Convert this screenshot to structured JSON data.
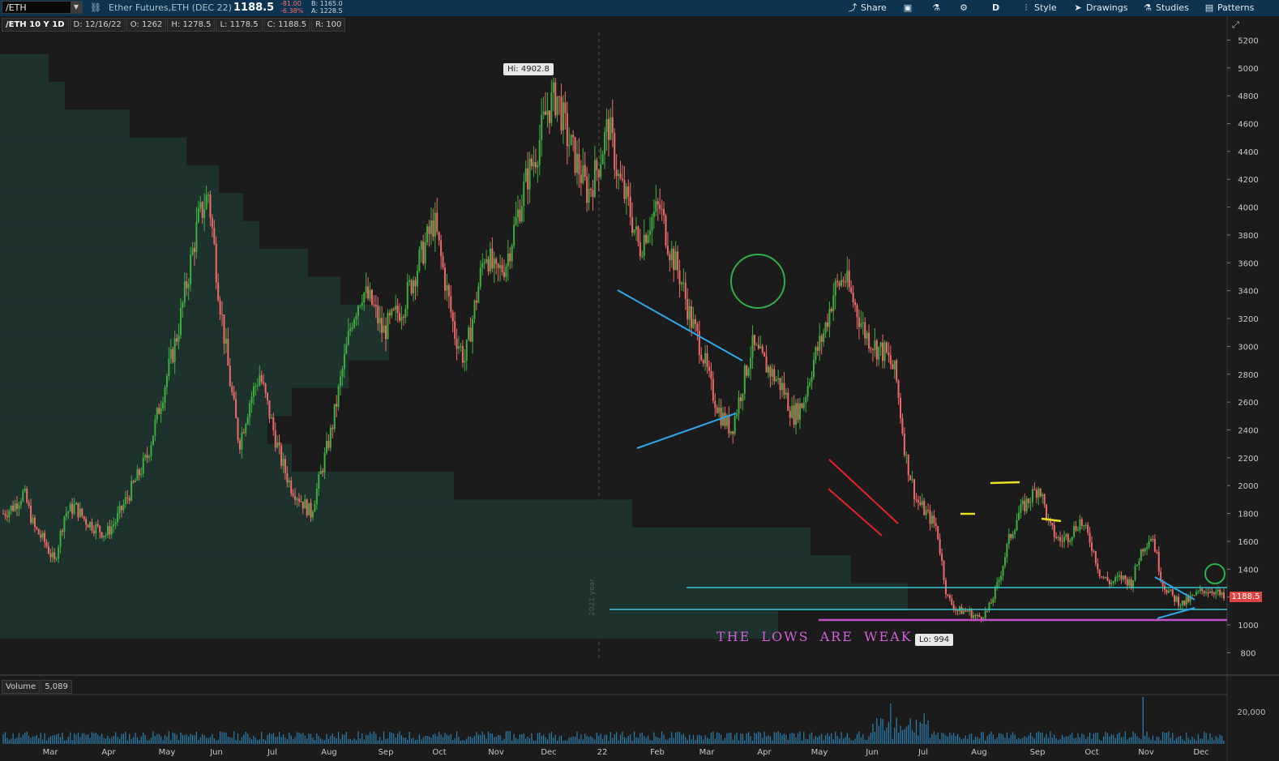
{
  "toolbar": {
    "symbol": "/ETH",
    "description": "Ether Futures,ETH (DEC 22)",
    "last_price": "1188.5",
    "change": "-81.00",
    "change_pct": "-6.38%",
    "bid": "B: 1165.0",
    "ask": "A: 1228.5",
    "share": "Share",
    "period": "D",
    "style": "Style",
    "drawings": "Drawings",
    "studies": "Studies",
    "patterns": "Patterns"
  },
  "info": {
    "chart_id": "/ETH 10 Y 1D",
    "date": "D: 12/16/22",
    "open": "O: 1262",
    "high": "H: 1278.5",
    "low": "L: 1178.5",
    "close": "C: 1188.5",
    "range": "R: 100"
  },
  "volume_info": {
    "label": "Volume",
    "value": "5,089"
  },
  "annotations": {
    "hi": "Hi: 4902.8",
    "lo": "Lo: 994",
    "lows_text": "THE LOWS ARE WEAK",
    "year_label": "2021 year",
    "price_tag": "1188.5"
  },
  "colors": {
    "up": "#3fae3f",
    "down": "#f06a6a",
    "trend": "#2ea6e8",
    "channel": "#e8202a",
    "circle": "#2fae4a",
    "support": "#37c3cf",
    "lows": "#c050c8",
    "tops": "#e8e020"
  },
  "chart_data": {
    "type": "candlestick",
    "x_ticks": [
      "Mar",
      "Apr",
      "May",
      "Jun",
      "Jul",
      "Aug",
      "Sep",
      "Oct",
      "Nov",
      "Dec",
      "22",
      "Feb",
      "Mar",
      "Apr",
      "May",
      "Jun",
      "Jul",
      "Aug",
      "Sep",
      "Oct",
      "Nov",
      "Dec"
    ],
    "y_ticks": [
      800,
      1000,
      1200,
      1400,
      1600,
      1800,
      2000,
      2200,
      2400,
      2600,
      2800,
      3000,
      3200,
      3400,
      3600,
      3800,
      4000,
      4200,
      4400,
      4600,
      4800,
      5000,
      5200
    ],
    "volume_ticks": [
      "20,000"
    ],
    "ylim": [
      700,
      5350
    ],
    "close_path": [
      1800,
      1850,
      1950,
      1700,
      1600,
      1450,
      1800,
      1850,
      1750,
      1700,
      1650,
      1750,
      1900,
      2050,
      2200,
      2500,
      2800,
      3100,
      3500,
      3900,
      4100,
      3400,
      2800,
      2300,
      2600,
      2800,
      2500,
      2200,
      2000,
      1900,
      1800,
      2100,
      2400,
      2800,
      3200,
      3400,
      3300,
      3100,
      3200,
      3300,
      3500,
      3700,
      3900,
      3500,
      3100,
      2900,
      3300,
      3700,
      3500,
      3600,
      3900,
      4200,
      4400,
      4700,
      4800,
      4500,
      4300,
      4100,
      4300,
      4600,
      4200,
      4000,
      3700,
      3900,
      4000,
      3700,
      3500,
      3200,
      3000,
      2700,
      2500,
      2400,
      2700,
      3000,
      2900,
      2800,
      2700,
      2500,
      2600,
      2900,
      3100,
      3400,
      3500,
      3300,
      3100,
      3000,
      2950,
      2800,
      2200,
      1900,
      1800,
      1700,
      1200,
      1100,
      1100,
      1050,
      1100,
      1300,
      1600,
      1800,
      1900,
      2000,
      1700,
      1600,
      1650,
      1750,
      1600,
      1350,
      1300,
      1340,
      1300,
      1550,
      1650,
      1300,
      1200,
      1150,
      1200,
      1250,
      1250,
      1188.5
    ]
  }
}
